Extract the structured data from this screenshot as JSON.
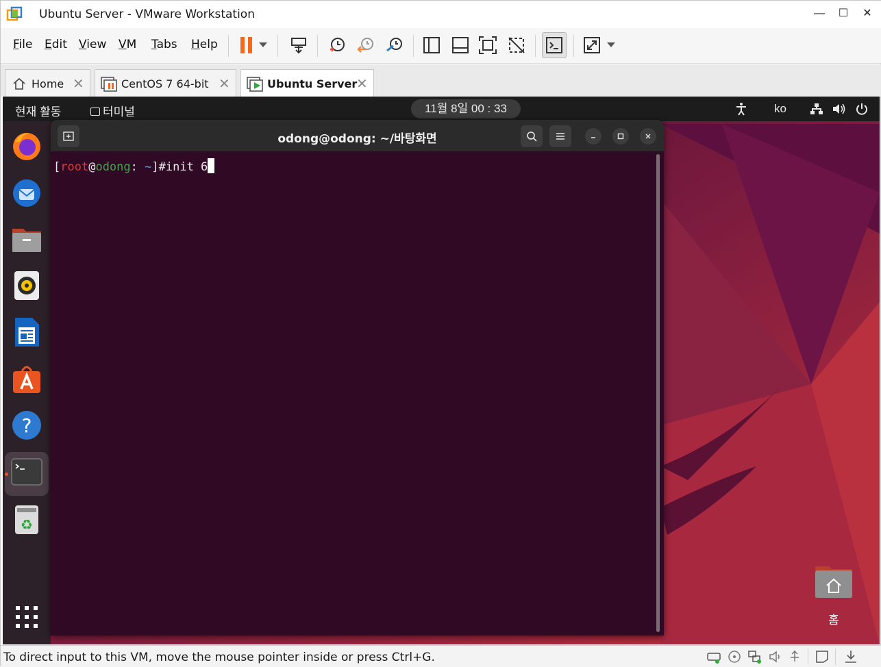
{
  "window": {
    "title": "Ubuntu Server - VMware Workstation",
    "minimize": "—",
    "maximize": "☐",
    "close": "✕"
  },
  "menu": {
    "items": [
      {
        "first": "F",
        "rest": "ile"
      },
      {
        "first": "E",
        "rest": "dit"
      },
      {
        "first": "V",
        "rest": "iew"
      },
      {
        "first": "V",
        "rest": "M"
      },
      {
        "first": "T",
        "rest": "abs"
      },
      {
        "first": "H",
        "rest": "elp"
      }
    ]
  },
  "tabs": [
    {
      "label": "Home",
      "close": "✕"
    },
    {
      "label": "CentOS 7 64-bit",
      "close": "✕"
    },
    {
      "label": "Ubuntu Server",
      "close": "✕"
    }
  ],
  "guest": {
    "activities": "현재 활동",
    "terminal_app": "터미널",
    "clock": "11월 8일  00 : 33",
    "lang": "ko",
    "terminal": {
      "title": "odong@odong: ~/바탕화면",
      "prompt_open": "[",
      "user": "root",
      "at": "@",
      "host": "odong",
      "sep": ": ",
      "path": "~",
      "prompt_close": "]#",
      "command": "init 6"
    },
    "desktop_home_label": "홈"
  },
  "status": {
    "text": "To direct input to this VM, move the mouse pointer inside or press Ctrl+G."
  },
  "colors": {
    "ubuntu_orange": "#e95420",
    "terminal_bg": "#300a24",
    "pause_orange": "#f26b1d"
  }
}
